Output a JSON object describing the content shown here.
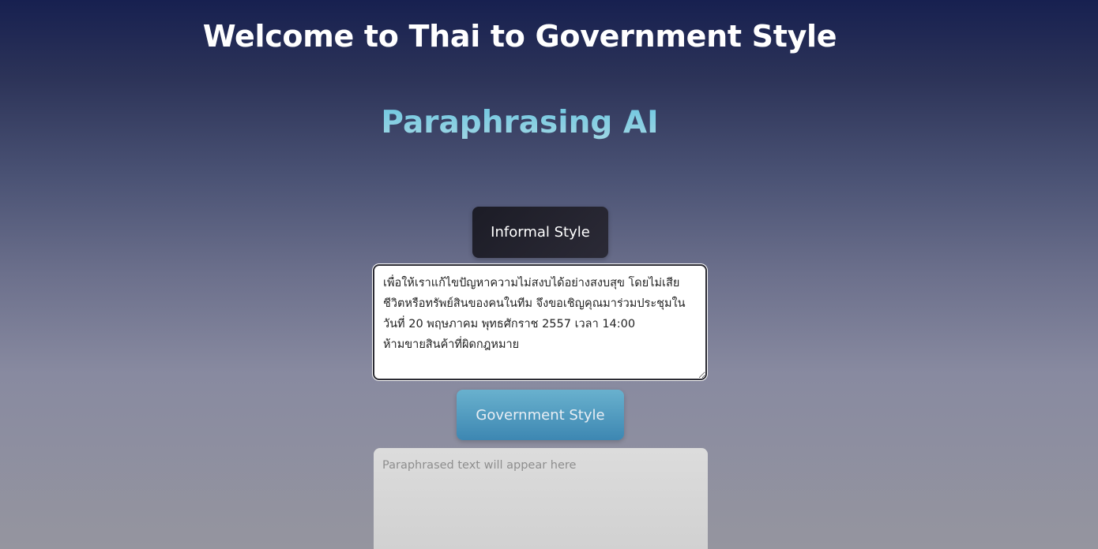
{
  "header": {
    "title": "Welcome to Thai to Government Style",
    "subtitle": "Paraphrasing AI"
  },
  "input_section": {
    "informal_button_label": "Informal Style",
    "input_text": "เพื่อให้เราแก้ไขปัญหาความไม่สงบได้อย่างสงบสุข โดยไม่เสียชีวิตหรือทรัพย์สินของคนในทีม จึงขอเชิญคุณมาร่วมประชุมในวันที่ 20 พฤษภาคม พุทธศักราช 2557 เวลา 14:00\nห้ามขายสินค้าที่ผิดกฎหมาย"
  },
  "output_section": {
    "government_button_label": "Government Style",
    "output_placeholder": "Paraphrased text will appear here",
    "output_text": ""
  }
}
